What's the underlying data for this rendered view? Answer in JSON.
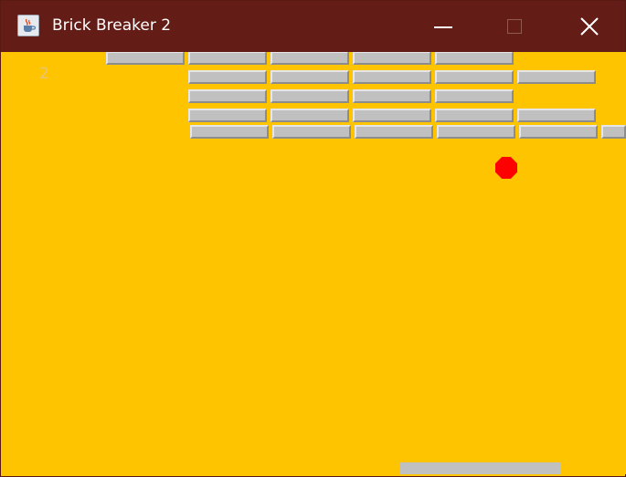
{
  "window": {
    "title": "Brick Breaker 2",
    "icon": "java-cup-icon",
    "controls": [
      "minimize-icon",
      "maximize-icon",
      "close-icon"
    ]
  },
  "game": {
    "score": "2",
    "colors": {
      "background": "#ffc400",
      "brick": "#c0c0c0",
      "ball": "#ff0000",
      "paddle": "#c0c0c0",
      "titlebar": "#641c16"
    }
  }
}
